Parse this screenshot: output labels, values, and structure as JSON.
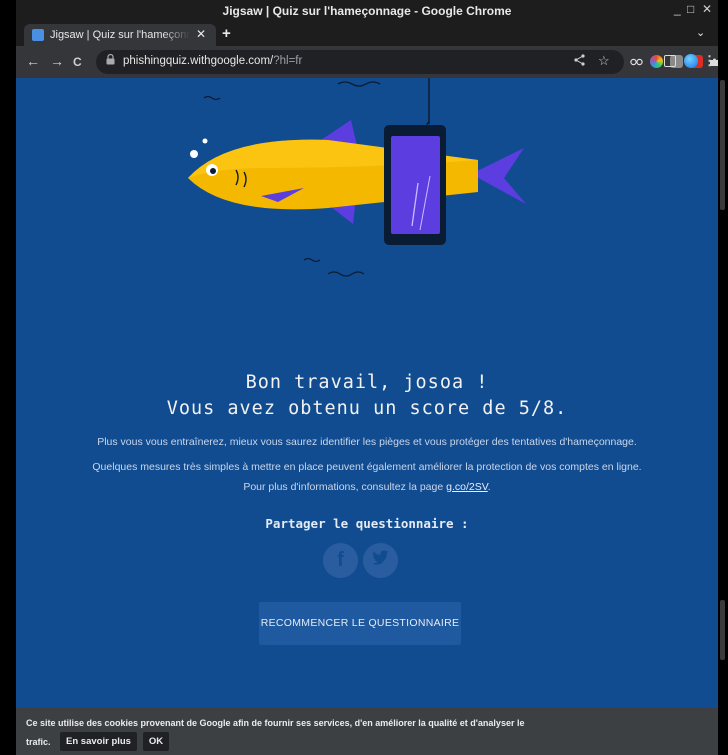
{
  "window": {
    "title": "Jigsaw | Quiz sur l'hameçonnage - Google Chrome",
    "controls": [
      "_",
      "□",
      "✕"
    ]
  },
  "tab": {
    "label": "Jigsaw | Quiz sur l'hameçonnage",
    "close_glyph": "✕",
    "new_tab_glyph": "+",
    "tab_menu_glyph": "⌄"
  },
  "toolbar": {
    "back_glyph": "←",
    "forward_glyph": "→",
    "reload_glyph": "C",
    "lock_glyph": "🔒",
    "url_host": "phishingquiz.withgoogle.com/",
    "url_query": "?hl=fr",
    "share_glyph": "<",
    "star_glyph": "☆",
    "menu_glyph": "⋮",
    "extension_icons": [
      "glasses-extension-icon",
      "colorwheel-extension-icon",
      "copy-extension-icon",
      "red-extension-icon",
      "puzzle-extension-icon",
      "sidepanel-icon",
      "profile-avatar-icon"
    ]
  },
  "result": {
    "line1": "Bon travail, josoa !",
    "line2": "Vous avez obtenu un score de 5/8.",
    "para1": "Plus vous vous entraînerez, mieux vous saurez identifier les pièges et vous protéger des tentatives d'hameçonnage.",
    "para2": "Quelques mesures très simples à mettre en place peuvent également améliorer la protection de vos comptes en ligne.",
    "para3_prefix": "Pour plus d'informations, consultez la page ",
    "para3_link": "g.co/2SV",
    "para3_suffix": "."
  },
  "share": {
    "heading": "Partager le questionnaire :",
    "facebook_glyph": "f",
    "twitter_glyph": "t"
  },
  "restart_button": "RECOMMENCER LE QUESTIONNAIRE",
  "cookie_banner": {
    "message_line1": "Ce site utilise des cookies provenant de Google afin de fournir ses services, d'en améliorer la qualité et d'analyser le",
    "message_line2": "trafic.",
    "learn_more": "En savoir plus",
    "ok": "OK"
  },
  "colors": {
    "page_background": "#124c90",
    "fish_body": "#f5b800",
    "fish_fins": "#5b3de0",
    "phone_screen": "#5b3de0"
  }
}
